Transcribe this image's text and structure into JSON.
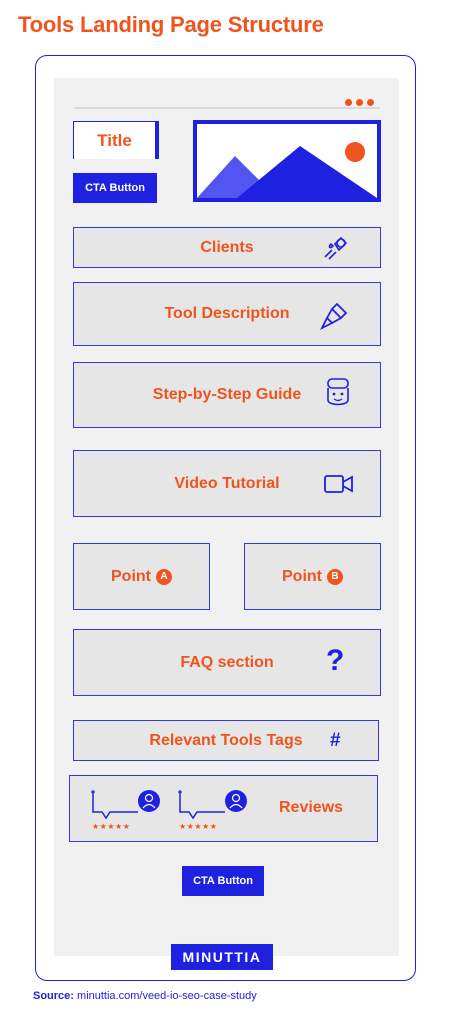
{
  "heading": "Tools Landing Page Structure",
  "hero": {
    "title": "Title",
    "cta": "CTA Button"
  },
  "sections": {
    "clients": "Clients",
    "tool_description": "Tool Description",
    "guide": "Step-by-Step Guide",
    "video": "Video Tutorial",
    "point_a": "Point",
    "point_a_badge": "A",
    "point_b": "Point",
    "point_b_badge": "B",
    "faq": "FAQ section",
    "faq_icon": "?",
    "tags": "Relevant Tools Tags",
    "tags_icon": "#",
    "reviews": "Reviews",
    "stars": "★★★★★"
  },
  "bottom_cta": "CTA Button",
  "logo": "MINUTTIA",
  "source": {
    "label": "Source:",
    "url": "minuttia.com/veed-io-seo-case-study"
  },
  "colors": {
    "accent": "#f0541e",
    "brand": "#1f21e0",
    "panel": "#e6e6e6",
    "screen": "#f1f1f1"
  }
}
